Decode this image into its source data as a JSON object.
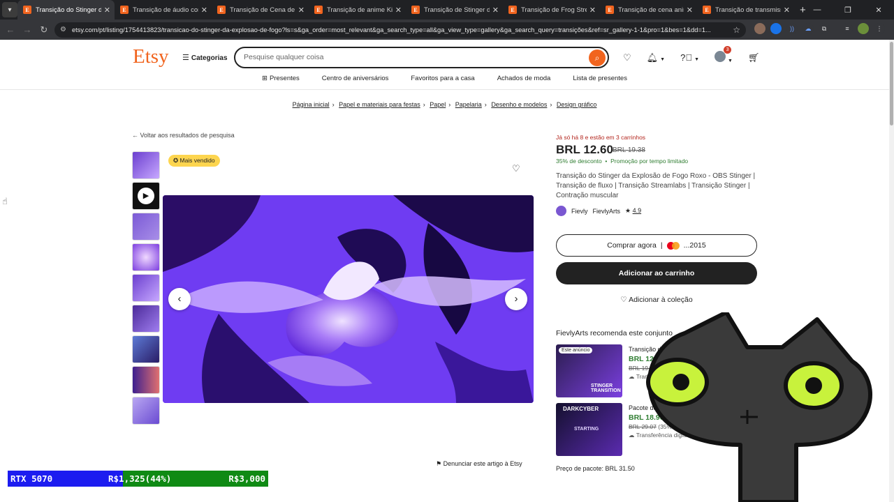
{
  "browser": {
    "tabs": [
      {
        "title": "Transição do Stinger da Ex",
        "active": true
      },
      {
        "title": "Transição de áudio com g",
        "active": false
      },
      {
        "title": "Transição de Cena de Flu",
        "active": false
      },
      {
        "title": "Transição de anime Kid M",
        "active": false
      },
      {
        "title": "Transição de Stinger de B",
        "active": false
      },
      {
        "title": "Transição de Frog Stream",
        "active": false
      },
      {
        "title": "Transição de cena animac",
        "active": false
      },
      {
        "title": "Transição de transmissão",
        "active": false
      }
    ],
    "tab_favicon": "E",
    "url": "etsy.com/pt/listing/1754413823/transicao-do-stinger-da-explosao-de-fogo?ls=s&ga_order=most_relevant&ga_search_type=all&ga_view_type=gallery&ga_search_query=transições&ref=sr_gallery-1-1&pro=1&bes=1&dd=1..."
  },
  "header": {
    "logo": "Etsy",
    "categories": "Categorias",
    "search_placeholder": "Pesquise qualquer coisa",
    "notif_count": "3"
  },
  "subnav": [
    "Presentes",
    "Centro de aniversários",
    "Favoritos para a casa",
    "Achados de moda",
    "Lista de presentes"
  ],
  "breadcrumb": [
    "Página inicial",
    "Papel e materiais para festas",
    "Papel",
    "Papelaria",
    "Desenho e modelos",
    "Design gráfico"
  ],
  "back_link": "Voltar aos resultados de pesquisa",
  "badge": "Mais vendido",
  "report": "Denunciar este artigo à Etsy",
  "listing": {
    "stock_note": "Já só há 8 e estão em 3 carrinhos",
    "price": "BRL 12.60",
    "old_price": "BRL 19.38",
    "discount": "35% de desconto",
    "promo": "Promoção por tempo limitado",
    "title": "Transição do Stinger da Explosão de Fogo Roxo - OBS Stinger | Transição de fluxo | Transição Streamlabs | Transição Stinger | Contração muscular",
    "seller_short": "Fievly",
    "seller_name": "FievlyArts",
    "rating": "4.9",
    "buy_now": "Comprar agora",
    "card_last": "...2015",
    "add_to_cart": "Adicionar ao carrinho",
    "add_to_collection": "Adicionar à coleção"
  },
  "recommend": {
    "title": "FievlyArts recomenda este conjunto",
    "items": [
      {
        "tag": "Este anúncio",
        "name": "Transição do Stinger da Explo",
        "price": "BRL 12.60",
        "old": "BRL 19.",
        "delivery": "Transf",
        "art_label": "STINGER TRANSITION"
      },
      {
        "name": "Pacote de so",
        "price": "BRL 18.90",
        "old": "BRL 29.07",
        "discount": "(35% de d",
        "delivery": "Transferência digital",
        "art_label": "DARKCYBER",
        "art_label2": "STARTING"
      }
    ],
    "bundle_price": "Preço de pacote: BRL 31.50"
  },
  "overlay": {
    "label": "RTX 5070",
    "progress": "R$1,325(44%)",
    "goal": "R$3,000"
  },
  "colors": {
    "etsy_orange": "#f1641e",
    "price_green": "#2f7d31",
    "stock_red": "#b3261e",
    "bar_blue": "#1c1cf0",
    "bar_green": "#0f8a14"
  }
}
